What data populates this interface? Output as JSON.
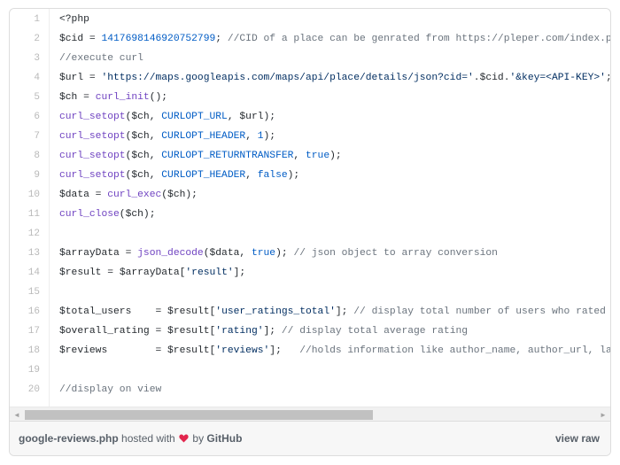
{
  "code": {
    "lines": [
      {
        "num": "1",
        "tokens": [
          {
            "t": "<?php",
            "c": "t-var"
          }
        ]
      },
      {
        "num": "2",
        "tokens": [
          {
            "t": "$cid",
            "c": "t-vr2"
          },
          {
            "t": " = ",
            "c": "t-var"
          },
          {
            "t": "1417698146920752799",
            "c": "t-cn"
          },
          {
            "t": "; ",
            "c": "t-var"
          },
          {
            "t": "//CID of a place can be genrated from https://pleper.com/index.php?do=t",
            "c": "t-cm"
          }
        ]
      },
      {
        "num": "3",
        "tokens": [
          {
            "t": "//execute curl",
            "c": "t-cm"
          }
        ]
      },
      {
        "num": "4",
        "tokens": [
          {
            "t": "$url",
            "c": "t-vr2"
          },
          {
            "t": " = ",
            "c": "t-var"
          },
          {
            "t": "'https://maps.googleapis.com/maps/api/place/details/json?cid='",
            "c": "t-st"
          },
          {
            "t": ".",
            "c": "t-var"
          },
          {
            "t": "$cid",
            "c": "t-vr2"
          },
          {
            "t": ".",
            "c": "t-var"
          },
          {
            "t": "'&key=<API-KEY>'",
            "c": "t-st"
          },
          {
            "t": ";",
            "c": "t-var"
          }
        ]
      },
      {
        "num": "5",
        "tokens": [
          {
            "t": "$ch",
            "c": "t-vr2"
          },
          {
            "t": " = ",
            "c": "t-var"
          },
          {
            "t": "curl_init",
            "c": "t-fn"
          },
          {
            "t": "();",
            "c": "t-var"
          }
        ]
      },
      {
        "num": "6",
        "tokens": [
          {
            "t": "curl_setopt",
            "c": "t-fn"
          },
          {
            "t": "(",
            "c": "t-var"
          },
          {
            "t": "$ch",
            "c": "t-vr2"
          },
          {
            "t": ", ",
            "c": "t-var"
          },
          {
            "t": "CURLOPT_URL",
            "c": "t-cn"
          },
          {
            "t": ", ",
            "c": "t-var"
          },
          {
            "t": "$url",
            "c": "t-vr2"
          },
          {
            "t": ");",
            "c": "t-var"
          }
        ]
      },
      {
        "num": "7",
        "tokens": [
          {
            "t": "curl_setopt",
            "c": "t-fn"
          },
          {
            "t": "(",
            "c": "t-var"
          },
          {
            "t": "$ch",
            "c": "t-vr2"
          },
          {
            "t": ", ",
            "c": "t-var"
          },
          {
            "t": "CURLOPT_HEADER",
            "c": "t-cn"
          },
          {
            "t": ", ",
            "c": "t-var"
          },
          {
            "t": "1",
            "c": "t-cn"
          },
          {
            "t": ");",
            "c": "t-var"
          }
        ]
      },
      {
        "num": "8",
        "tokens": [
          {
            "t": "curl_setopt",
            "c": "t-fn"
          },
          {
            "t": "(",
            "c": "t-var"
          },
          {
            "t": "$ch",
            "c": "t-vr2"
          },
          {
            "t": ", ",
            "c": "t-var"
          },
          {
            "t": "CURLOPT_RETURNTRANSFER",
            "c": "t-cn"
          },
          {
            "t": ", ",
            "c": "t-var"
          },
          {
            "t": "true",
            "c": "t-cn"
          },
          {
            "t": ");",
            "c": "t-var"
          }
        ]
      },
      {
        "num": "9",
        "tokens": [
          {
            "t": "curl_setopt",
            "c": "t-fn"
          },
          {
            "t": "(",
            "c": "t-var"
          },
          {
            "t": "$ch",
            "c": "t-vr2"
          },
          {
            "t": ", ",
            "c": "t-var"
          },
          {
            "t": "CURLOPT_HEADER",
            "c": "t-cn"
          },
          {
            "t": ", ",
            "c": "t-var"
          },
          {
            "t": "false",
            "c": "t-cn"
          },
          {
            "t": ");",
            "c": "t-var"
          }
        ]
      },
      {
        "num": "10",
        "tokens": [
          {
            "t": "$data",
            "c": "t-vr2"
          },
          {
            "t": " = ",
            "c": "t-var"
          },
          {
            "t": "curl_exec",
            "c": "t-fn"
          },
          {
            "t": "(",
            "c": "t-var"
          },
          {
            "t": "$ch",
            "c": "t-vr2"
          },
          {
            "t": ");",
            "c": "t-var"
          }
        ]
      },
      {
        "num": "11",
        "tokens": [
          {
            "t": "curl_close",
            "c": "t-fn"
          },
          {
            "t": "(",
            "c": "t-var"
          },
          {
            "t": "$ch",
            "c": "t-vr2"
          },
          {
            "t": ");",
            "c": "t-var"
          }
        ]
      },
      {
        "num": "12",
        "tokens": []
      },
      {
        "num": "13",
        "tokens": [
          {
            "t": "$arrayData",
            "c": "t-vr2"
          },
          {
            "t": " = ",
            "c": "t-var"
          },
          {
            "t": "json_decode",
            "c": "t-fn"
          },
          {
            "t": "(",
            "c": "t-var"
          },
          {
            "t": "$data",
            "c": "t-vr2"
          },
          {
            "t": ", ",
            "c": "t-var"
          },
          {
            "t": "true",
            "c": "t-cn"
          },
          {
            "t": "); ",
            "c": "t-var"
          },
          {
            "t": "// json object to array conversion",
            "c": "t-cm"
          }
        ]
      },
      {
        "num": "14",
        "tokens": [
          {
            "t": "$result",
            "c": "t-vr2"
          },
          {
            "t": " = ",
            "c": "t-var"
          },
          {
            "t": "$arrayData",
            "c": "t-vr2"
          },
          {
            "t": "[",
            "c": "t-var"
          },
          {
            "t": "'result'",
            "c": "t-st"
          },
          {
            "t": "];",
            "c": "t-var"
          }
        ]
      },
      {
        "num": "15",
        "tokens": []
      },
      {
        "num": "16",
        "tokens": [
          {
            "t": "$total_users",
            "c": "t-vr2"
          },
          {
            "t": "    = ",
            "c": "t-var"
          },
          {
            "t": "$result",
            "c": "t-vr2"
          },
          {
            "t": "[",
            "c": "t-var"
          },
          {
            "t": "'user_ratings_total'",
            "c": "t-st"
          },
          {
            "t": "]; ",
            "c": "t-var"
          },
          {
            "t": "// display total number of users who rated",
            "c": "t-cm"
          }
        ]
      },
      {
        "num": "17",
        "tokens": [
          {
            "t": "$overall_rating",
            "c": "t-vr2"
          },
          {
            "t": " = ",
            "c": "t-var"
          },
          {
            "t": "$result",
            "c": "t-vr2"
          },
          {
            "t": "[",
            "c": "t-var"
          },
          {
            "t": "'rating'",
            "c": "t-st"
          },
          {
            "t": "]; ",
            "c": "t-var"
          },
          {
            "t": "// display total average rating",
            "c": "t-cm"
          }
        ]
      },
      {
        "num": "18",
        "tokens": [
          {
            "t": "$reviews",
            "c": "t-vr2"
          },
          {
            "t": "        = ",
            "c": "t-var"
          },
          {
            "t": "$result",
            "c": "t-vr2"
          },
          {
            "t": "[",
            "c": "t-var"
          },
          {
            "t": "'reviews'",
            "c": "t-st"
          },
          {
            "t": "];   ",
            "c": "t-var"
          },
          {
            "t": "//holds information like author_name, author_url, language",
            "c": "t-cm"
          }
        ]
      },
      {
        "num": "19",
        "tokens": []
      },
      {
        "num": "20",
        "tokens": [
          {
            "t": "//display on view",
            "c": "t-cm"
          }
        ]
      }
    ]
  },
  "scrollbar": {
    "left_arrow": "◄",
    "right_arrow": "►",
    "thumb_fraction": 0.6
  },
  "footer": {
    "filename": "google-reviews.php",
    "hosted_text": " hosted with ",
    "by_text": " by ",
    "host": "GitHub",
    "raw_label": "view raw",
    "heart_color": "#e2264d"
  }
}
